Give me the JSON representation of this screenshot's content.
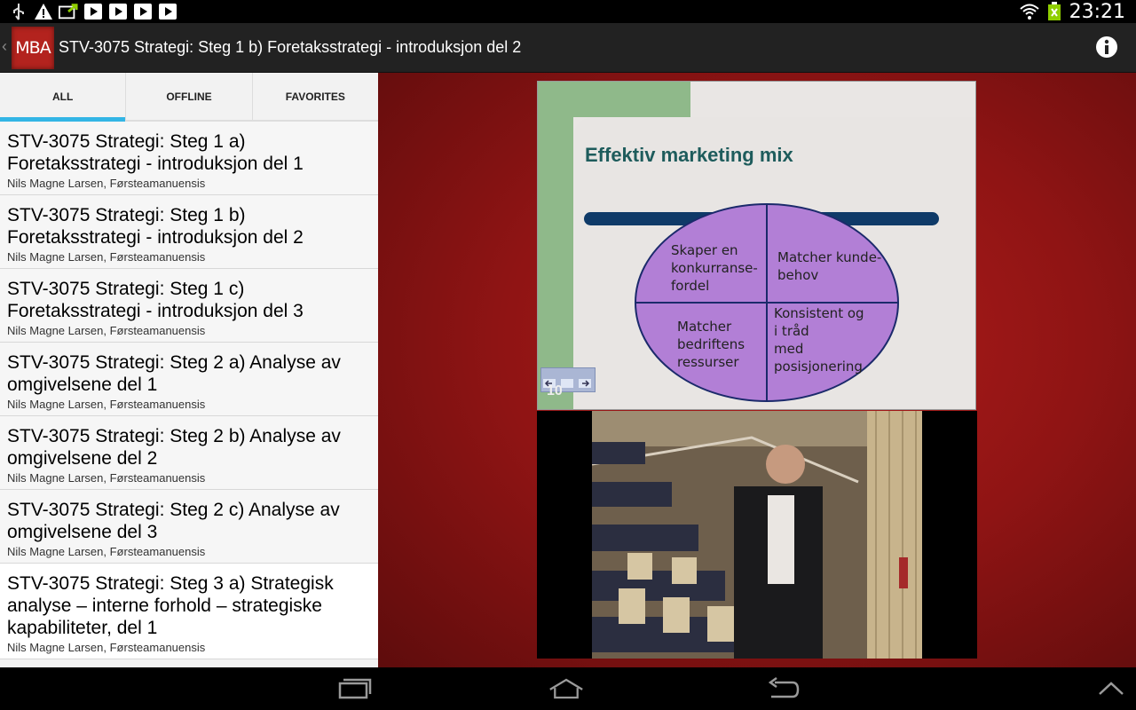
{
  "status_bar": {
    "time": "23:21",
    "left_icons": [
      "usb-icon",
      "warning-icon",
      "sync-icon",
      "play-store-icon",
      "play-store-icon",
      "play-store-icon",
      "play-store-icon"
    ],
    "right_icons": [
      "wifi-icon",
      "battery-icon"
    ]
  },
  "action_bar": {
    "logo_text": "MBA",
    "title": "STV-3075 Strategi: Steg 1 b) Foretaksstrategi - introduksjon del 2"
  },
  "tabs": [
    {
      "label": "ALL",
      "selected": true
    },
    {
      "label": "OFFLINE",
      "selected": false
    },
    {
      "label": "FAVORITES",
      "selected": false
    }
  ],
  "lectures": [
    {
      "title": "STV-3075 Strategi: Steg 1 a) Foretaksstrategi - introduksjon del 1",
      "author": "Nils Magne Larsen, Førsteamanuensis"
    },
    {
      "title": "STV-3075 Strategi: Steg 1 b) Foretaksstrategi - introduksjon del 2",
      "author": "Nils Magne Larsen, Førsteamanuensis"
    },
    {
      "title": "STV-3075 Strategi: Steg 1 c) Foretaksstrategi - introduksjon del 3",
      "author": "Nils Magne Larsen, Førsteamanuensis"
    },
    {
      "title": "STV-3075 Strategi: Steg 2 a) Analyse av omgivelsene del 1",
      "author": "Nils Magne Larsen, Førsteamanuensis"
    },
    {
      "title": "STV-3075 Strategi: Steg 2 b) Analyse av omgivelsene del 2",
      "author": "Nils Magne Larsen, Førsteamanuensis"
    },
    {
      "title": "STV-3075 Strategi: Steg 2 c) Analyse av omgivelsene del 3",
      "author": "Nils Magne Larsen, Førsteamanuensis"
    },
    {
      "title": "STV-3075 Strategi: Steg 3 a) Strategisk analyse – interne forhold – strategiske kapabiliteter, del 1",
      "author": "Nils Magne Larsen, Førsteamanuensis"
    }
  ],
  "slide": {
    "title": "Effektiv marketing mix",
    "q1": "Skaper en\nkonkurranse-\nfordel",
    "q2": "Matcher kunde-\nbehov",
    "q3": "Matcher\nbedriftens\nressurser",
    "q4": "Konsistent og\ni tråd\nmed\nposisjonering",
    "page_number": "10"
  },
  "colors": {
    "accent": "#33b5e5",
    "logo_red": "#b3231e",
    "slide_green": "#8fb98a",
    "slide_bar": "#0f3a68",
    "ellipse_fill": "#b27fd6"
  }
}
